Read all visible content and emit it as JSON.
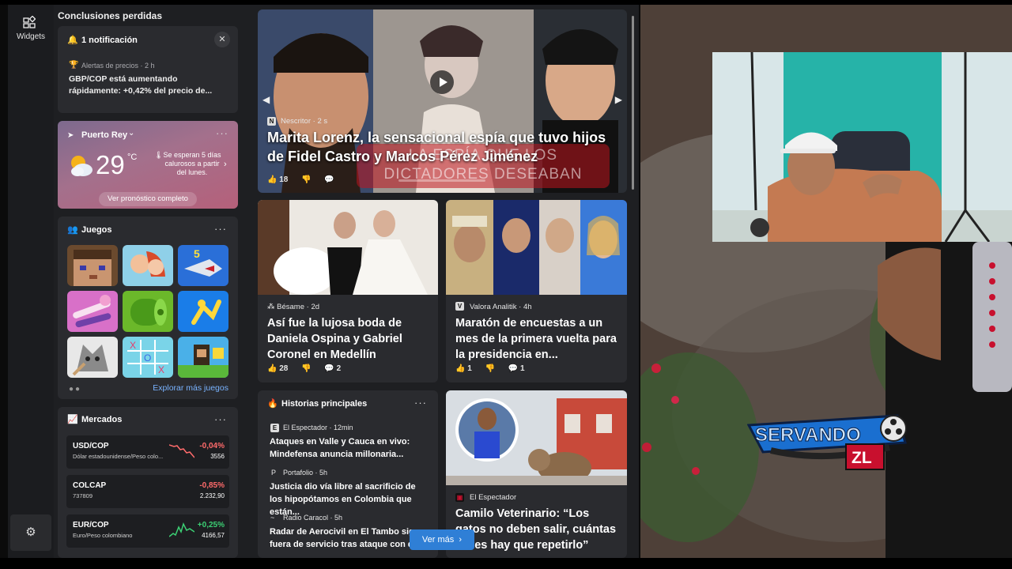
{
  "widgets_rail": {
    "label": "Widgets"
  },
  "section_title": "Conclusiones perdidas",
  "notification": {
    "title": "1 notificación",
    "meta": "Alertas de precios · 2 h",
    "body": "GBP/COP está aumentando rápidamente: +0,42% del precio de..."
  },
  "weather": {
    "location": "Puerto Rey",
    "temperature": "29",
    "unit": "°C",
    "forecast": "Se esperan 5 días calurosos a partir del lunes.",
    "button": "Ver pronóstico completo"
  },
  "games": {
    "title": "Juegos",
    "more": "Explorar más juegos",
    "tiles": [
      "minecraft-style",
      "family-game",
      "shark-5",
      "makeup",
      "roll",
      "runner",
      "dog-art",
      "tic-tac-toe",
      "blocks"
    ]
  },
  "markets": {
    "title": "Mercados",
    "rows": [
      {
        "symbol": "USD/COP",
        "desc": "Dólar estadounidense/Peso colo...",
        "change": "-0,04%",
        "price": "3556",
        "trend": "down"
      },
      {
        "symbol": "COLCAP",
        "desc": "737809",
        "change": "-0,85%",
        "price": "2.232,90",
        "trend": "down"
      },
      {
        "symbol": "EUR/COP",
        "desc": "Euro/Peso colombiano",
        "change": "+0,25%",
        "price": "4166,57",
        "trend": "up"
      }
    ]
  },
  "hero": {
    "source": "Nescritor",
    "age": "2 s",
    "headline": "Marita Lorenz, la sensacional espía que tuvo hijos de Fidel Castro y Marcos Pérez Jiménez",
    "overlay_text": "LA ESPÍA QUE LOS DICTADORES DESEABAN",
    "likes": "18"
  },
  "news": [
    {
      "source": "Bésame",
      "age": "2d",
      "headline": "Así fue la lujosa boda de Daniela Ospina y Gabriel Coronel en Medellín",
      "likes": "28",
      "comments": "2"
    },
    {
      "source": "Valora Analitik",
      "age": "4h",
      "headline": "Maratón de encuestas a un mes de la primera vuelta para la presidencia en...",
      "likes": "1",
      "comments": "1"
    },
    {
      "source": "El Espectador",
      "age": "",
      "headline": "Camilo Veterinario: “Los gatos no deben salir, cuántas veces hay que repetirlo”"
    }
  ],
  "principal": {
    "title": "Historias principales",
    "items": [
      {
        "source": "El Espectador",
        "age": "12min",
        "headline": "Ataques en Valle y Cauca en vivo: Mindefensa anuncia millonaria..."
      },
      {
        "source": "Portafolio",
        "age": "5h",
        "headline": "Justicia dio vía libre al sacrificio de los hipopótamos en Colombia que están..."
      },
      {
        "source": "Radio Caracol",
        "age": "5h",
        "headline": "Radar de Aerocivil en El Tambo sigue fuera de servicio tras ataque con dron"
      }
    ]
  },
  "ver_mas": "Ver más",
  "logo": {
    "name": "SERVANDO",
    "sub": "ZL"
  },
  "colors": {
    "accent": "#2f7fd6",
    "negative": "#ff6b6b",
    "positive": "#3cd074"
  }
}
